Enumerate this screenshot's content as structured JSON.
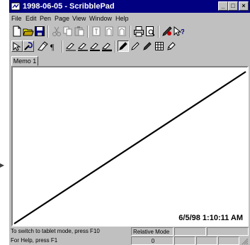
{
  "window": {
    "title": "1998-06-05 - ScribblePad",
    "controls": {
      "minimize": "_",
      "maximize": "□",
      "close": "×"
    }
  },
  "menu": [
    "File",
    "Edit",
    "Pen",
    "Page",
    "View",
    "Window",
    "Help"
  ],
  "toolbar1": {
    "icons": [
      "new-icon",
      "open-icon",
      "save-icon",
      "cut-icon",
      "copy-icon",
      "paste-icon",
      "page-left-icon",
      "page-icon",
      "page-right-icon",
      "print-icon",
      "print-preview-icon",
      "pen-settings-icon",
      "whats-this-help-icon"
    ]
  },
  "toolbar2": {
    "icons": [
      "select-tool-icon",
      "lasso-tool-icon",
      "eraser-tool-icon",
      "paragraph-icon",
      "line-style-1-icon",
      "line-style-2-icon",
      "line-style-3-icon",
      "line-style-4-icon",
      "pen-black-icon",
      "pen-outline-icon",
      "pen-gray-icon",
      "grid-icon",
      "highlighter-icon"
    ],
    "active": "pen-black-icon"
  },
  "tabs": [
    {
      "label": "Memo 1",
      "active": true
    }
  ],
  "canvas": {
    "timestamp": "6/5/98 1:10:11 AM",
    "stroke": {
      "from": "bottom-left",
      "to": "top-right",
      "color": "#000000"
    }
  },
  "status": {
    "line1": "To switch to tablet mode, press F10",
    "line2": "For Help, press F1",
    "mode": "Relative Mode",
    "count": "0"
  },
  "colors": {
    "title_bar": "#000080",
    "face": "#c0c0c0",
    "canvas": "#ffffff"
  }
}
